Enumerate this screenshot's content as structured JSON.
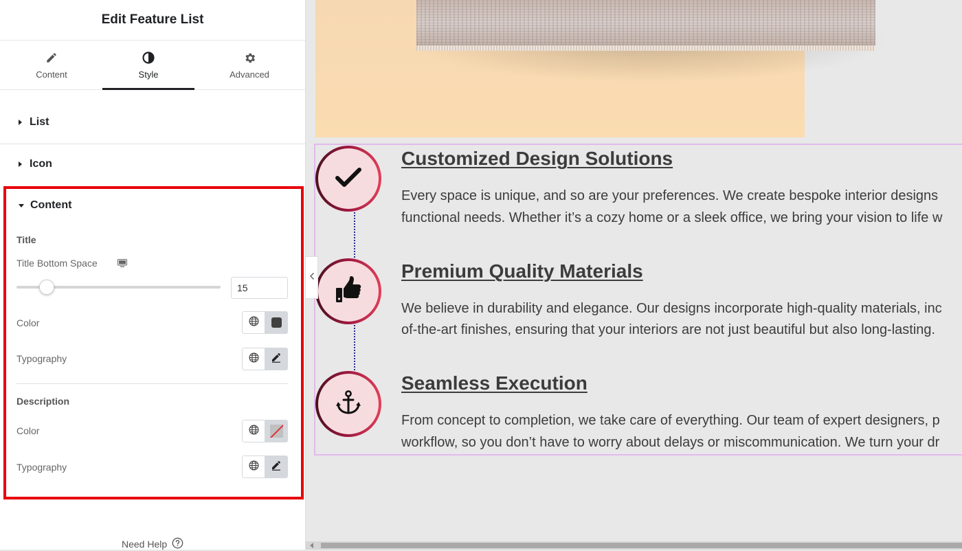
{
  "panel": {
    "title": "Edit Feature List",
    "tabs": [
      {
        "label": "Content",
        "icon": "pencil-icon",
        "active": false
      },
      {
        "label": "Style",
        "icon": "contrast-icon",
        "active": true
      },
      {
        "label": "Advanced",
        "icon": "gear-icon",
        "active": false
      }
    ],
    "sections": {
      "list": "List",
      "icon": "Icon",
      "content": "Content"
    },
    "title_group": {
      "heading": "Title",
      "bottom_space_label": "Title Bottom Space",
      "bottom_space_value": "15",
      "color_label": "Color",
      "typography_label": "Typography"
    },
    "description_group": {
      "heading": "Description",
      "color_label": "Color",
      "typography_label": "Typography"
    },
    "help": "Need Help"
  },
  "features": [
    {
      "icon": "check-icon",
      "title": "Customized Design Solutions",
      "desc_line1": "Every space is unique, and so are your preferences. We create bespoke interior designs",
      "desc_line2": "functional needs. Whether it’s a cozy home or a sleek office, we bring your vision to life w"
    },
    {
      "icon": "thumbs-up-icon",
      "title": "Premium Quality Materials",
      "desc_line1": "We believe in durability and elegance. Our designs incorporate high-quality materials, inc",
      "desc_line2": "of-the-art finishes, ensuring that your interiors are not just beautiful but also long-lasting."
    },
    {
      "icon": "anchor-icon",
      "title": "Seamless Execution",
      "desc_line1": "From concept to completion, we take care of everything. Our team of expert designers, p",
      "desc_line2": "workflow, so you don’t have to worry about delays or miscommunication. We turn your dr"
    }
  ],
  "colors": {
    "highlight_border": "#e8000b",
    "circle_gradient_start": "#4a1020",
    "circle_gradient_end": "#e0405a",
    "circle_fill": "#f7dcdf",
    "text": "#3c3c3c",
    "widget_outline": "#e3b9ec"
  }
}
